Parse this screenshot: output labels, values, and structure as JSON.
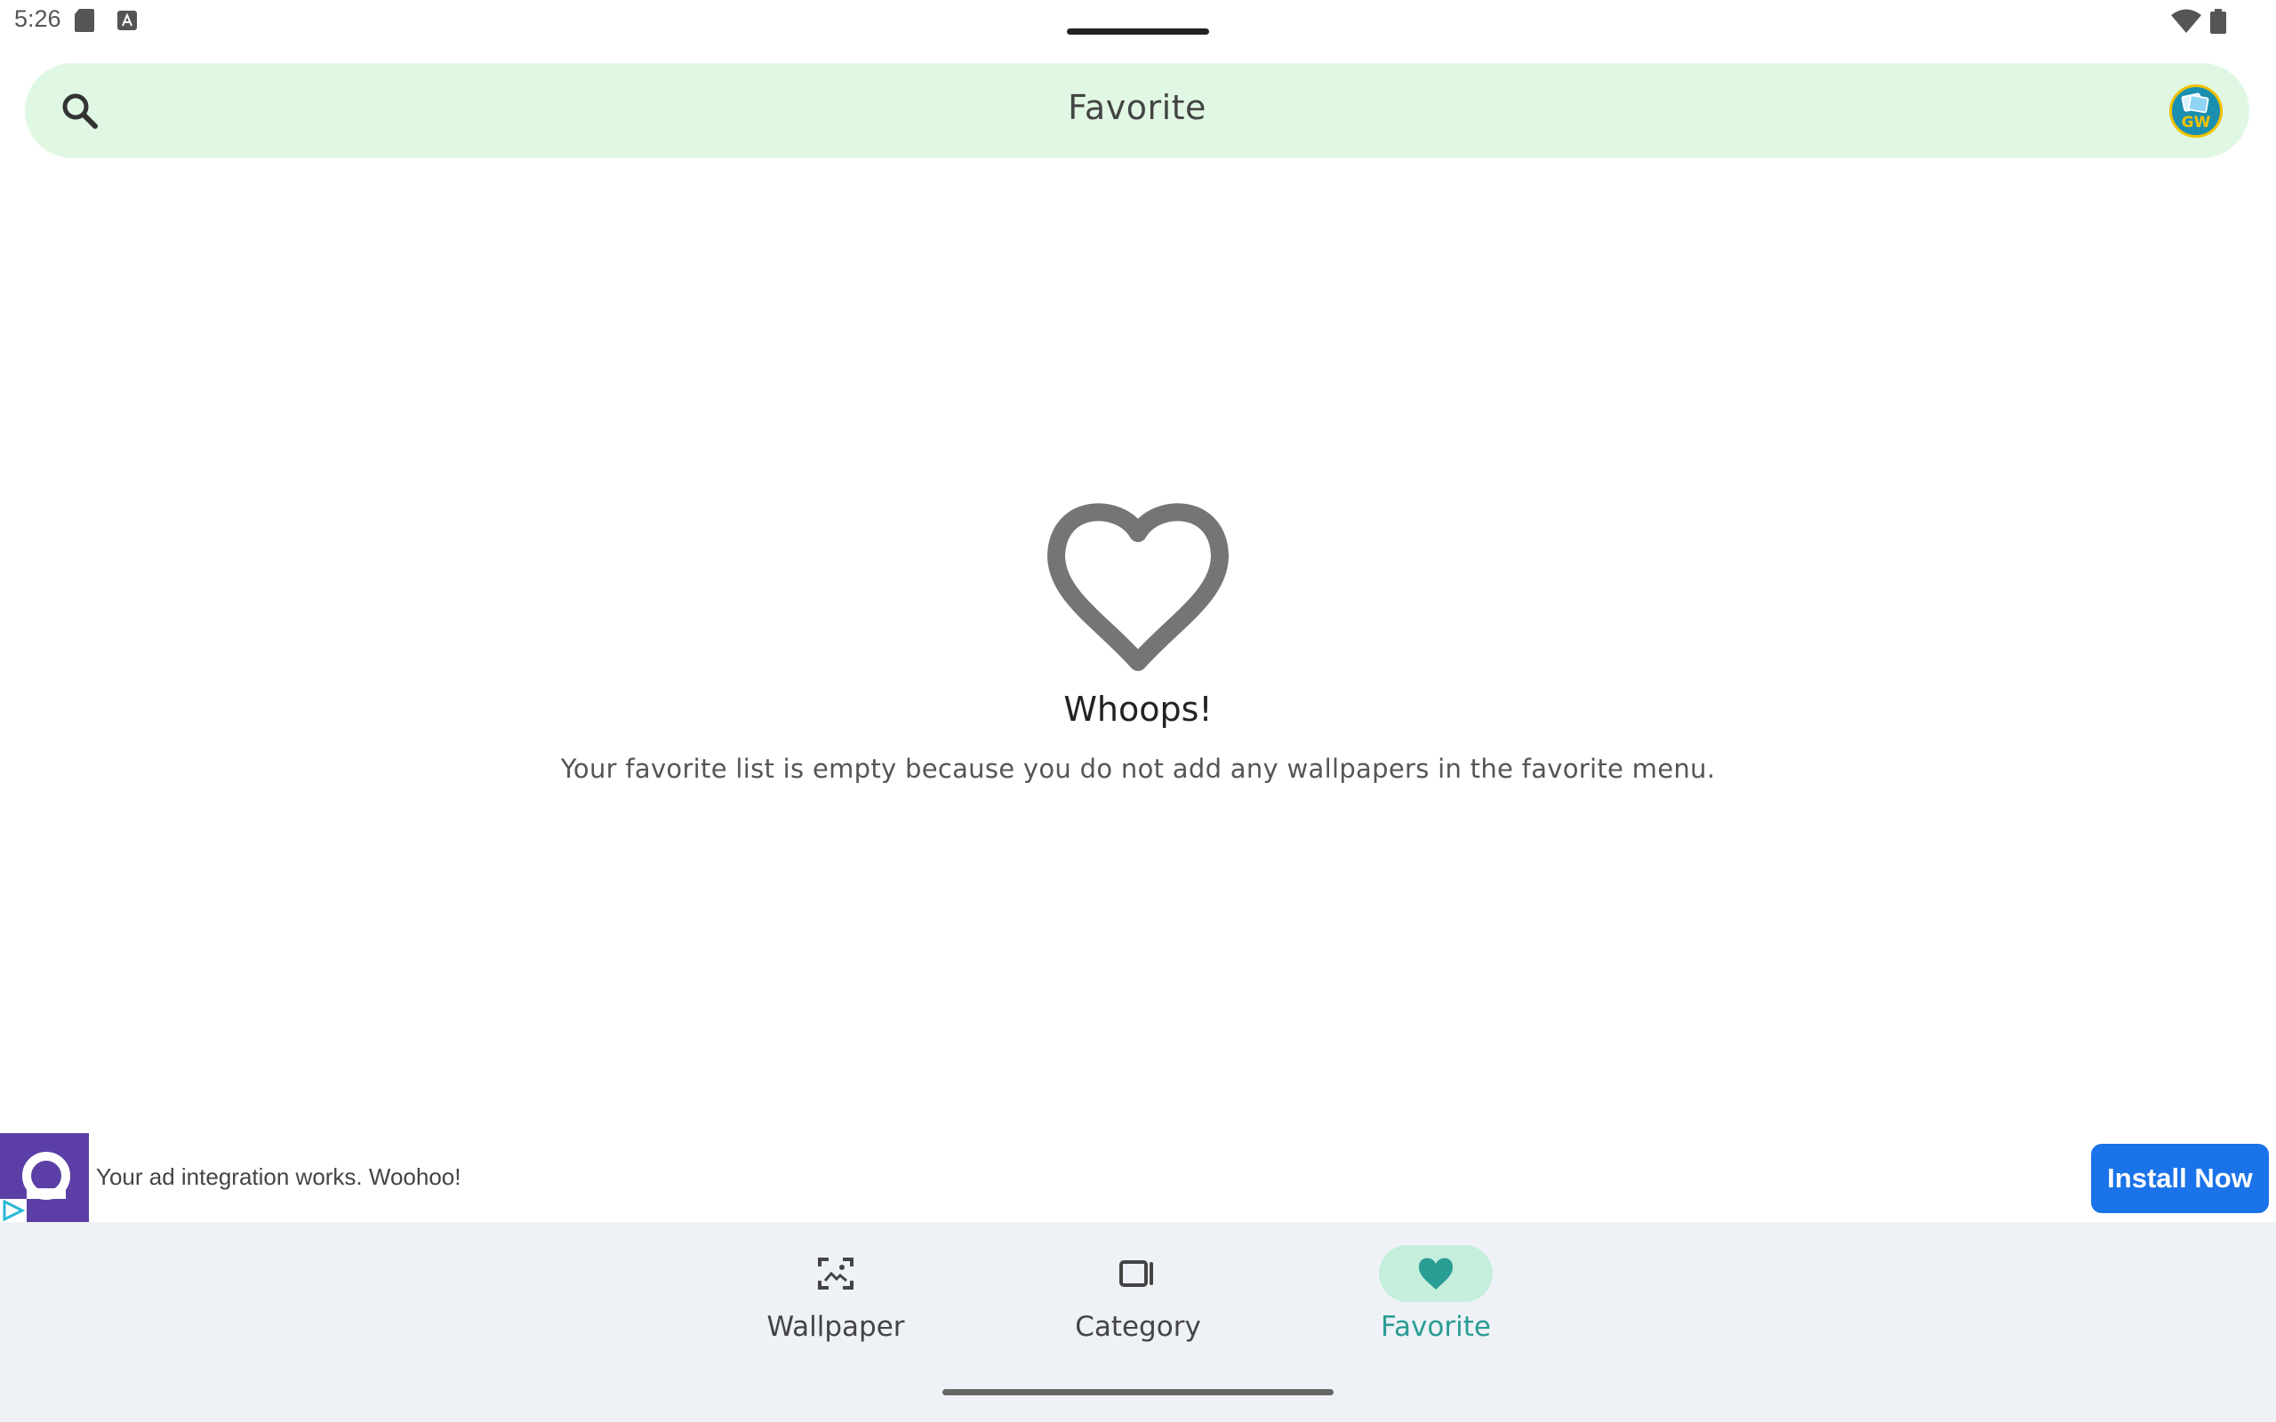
{
  "status": {
    "time": "5:26"
  },
  "search": {
    "title": "Favorite"
  },
  "avatar": {
    "text": "GW"
  },
  "empty_state": {
    "title": "Whoops!",
    "description": "Your favorite list is empty because you do not add any wallpapers in the favorite menu."
  },
  "ad": {
    "text": "Your ad integration works. Woohoo!",
    "button_label": "Install Now"
  },
  "nav": {
    "items": [
      {
        "label": "Wallpaper",
        "icon": "wallpaper-icon",
        "active": false
      },
      {
        "label": "Category",
        "icon": "category-icon",
        "active": false
      },
      {
        "label": "Favorite",
        "icon": "heart-icon",
        "active": true
      }
    ]
  },
  "colors": {
    "search_bg": "#e0f8e3",
    "accent": "#2a9d94",
    "nav_bg": "#eef2f6",
    "ad_button": "#1a73e8"
  }
}
